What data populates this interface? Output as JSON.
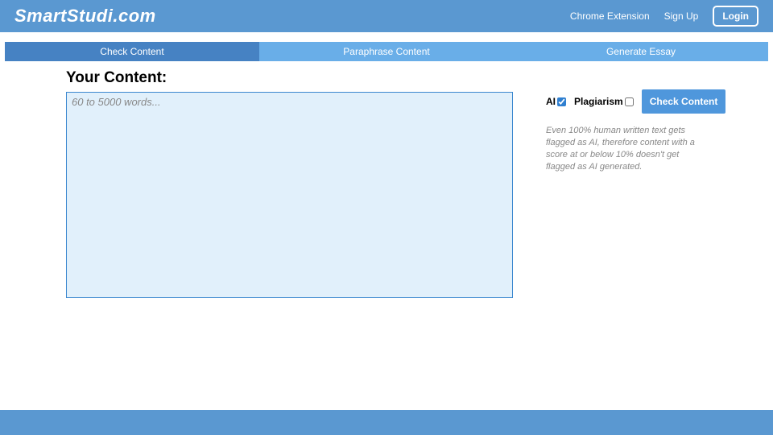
{
  "header": {
    "logo": "SmartStudi.com",
    "chrome_ext": "Chrome Extension",
    "sign_up": "Sign Up",
    "login": "Login"
  },
  "tabs": {
    "check": "Check Content",
    "paraphrase": "Paraphrase Content",
    "generate": "Generate Essay"
  },
  "main": {
    "heading": "Your Content:",
    "placeholder": "60 to 5000 words..."
  },
  "controls": {
    "ai_label": "AI",
    "ai_checked": true,
    "plagiarism_label": "Plagiarism",
    "plagiarism_checked": false,
    "button": "Check Content"
  },
  "disclaimer": "Even 100% human written text gets flagged as AI, therefore content with a score at or below 10% doesn't get flagged as AI generated."
}
